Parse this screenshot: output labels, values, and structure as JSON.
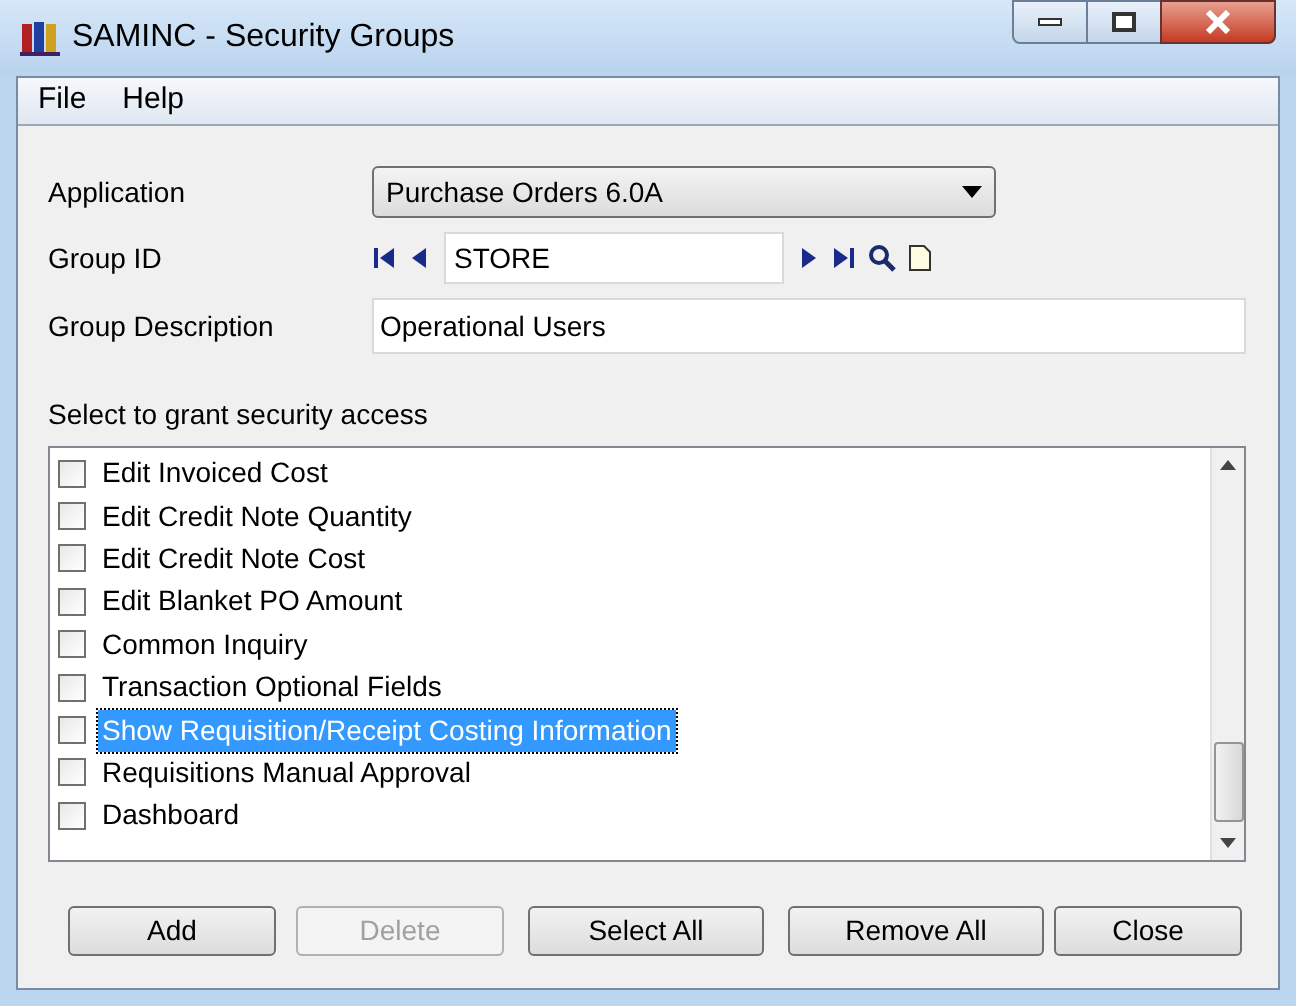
{
  "window": {
    "title": "SAMINC - Security Groups"
  },
  "menu": [
    "File",
    "Help"
  ],
  "application": {
    "label": "Application",
    "value": "Purchase Orders 6.0A"
  },
  "group_id": {
    "label": "Group ID",
    "value": "STORE"
  },
  "group_description": {
    "label": "Group Description",
    "value": "Operational Users"
  },
  "access_list": {
    "label": "Select to grant security access",
    "items": [
      {
        "label": "Edit Invoiced Cost",
        "checked": false,
        "selected": false
      },
      {
        "label": "Edit Credit Note Quantity",
        "checked": false,
        "selected": false
      },
      {
        "label": "Edit Credit Note Cost",
        "checked": false,
        "selected": false
      },
      {
        "label": "Edit Blanket PO Amount",
        "checked": false,
        "selected": false
      },
      {
        "label": "Common Inquiry",
        "checked": false,
        "selected": false
      },
      {
        "label": "Transaction Optional Fields",
        "checked": false,
        "selected": false
      },
      {
        "label": "Show Requisition/Receipt Costing Information",
        "checked": false,
        "selected": true
      },
      {
        "label": "Requisitions Manual Approval",
        "checked": false,
        "selected": false
      },
      {
        "label": "Dashboard",
        "checked": false,
        "selected": false
      }
    ]
  },
  "buttons": [
    {
      "label": "Add",
      "disabled": false
    },
    {
      "label": "Delete",
      "disabled": true
    },
    {
      "label": "Select All",
      "disabled": false
    },
    {
      "label": "Remove All",
      "disabled": false
    },
    {
      "label": "Close",
      "disabled": false
    }
  ]
}
